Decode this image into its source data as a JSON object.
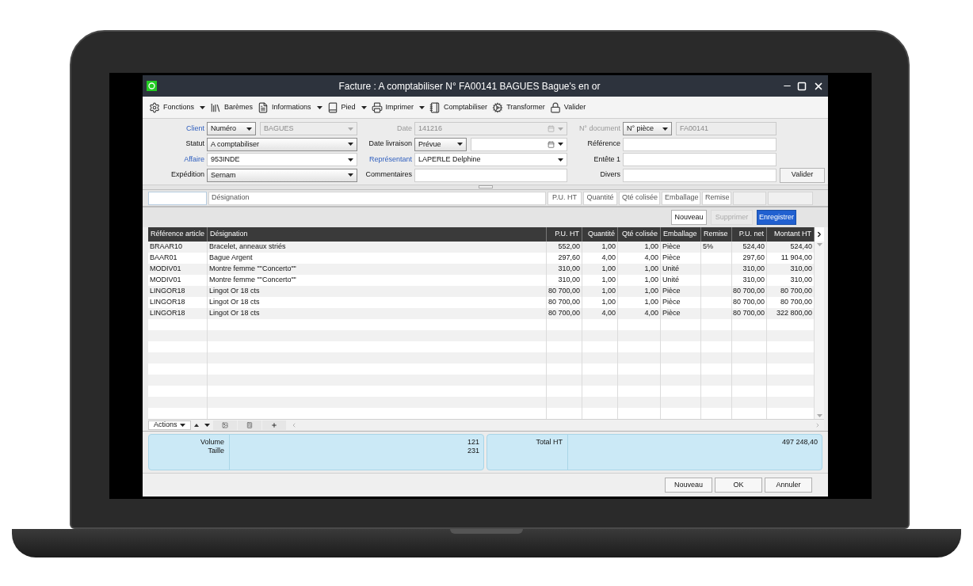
{
  "window": {
    "title": "Facture : A comptabiliser N° FA00141 BAGUES Bague's en or"
  },
  "toolbar": [
    {
      "label": "Fonctions",
      "menu": true
    },
    {
      "label": "Barèmes",
      "menu": false
    },
    {
      "label": "Informations",
      "menu": true
    },
    {
      "label": "Pied",
      "menu": true
    },
    {
      "label": "Imprimer",
      "menu": true
    },
    {
      "label": "Comptabiliser",
      "menu": false
    },
    {
      "label": "Transformer",
      "menu": false
    },
    {
      "label": "Valider",
      "menu": false
    }
  ],
  "form": {
    "columns": [
      {
        "fields": [
          {
            "label": "Client",
            "link": true,
            "disabled": false,
            "controls": [
              {
                "kind": "select",
                "value": "Numéro",
                "disabled": false
              },
              {
                "kind": "select",
                "value": "BAGUES",
                "disabled": true
              }
            ]
          },
          {
            "label": "Statut",
            "link": false,
            "disabled": false,
            "controls": [
              {
                "kind": "select",
                "value": "A comptabiliser",
                "disabled": false
              }
            ]
          },
          {
            "label": "Affaire",
            "link": true,
            "disabled": false,
            "controls": [
              {
                "kind": "combo",
                "value": "953INDE",
                "disabled": false
              }
            ]
          },
          {
            "label": "Expédition",
            "link": false,
            "disabled": false,
            "controls": [
              {
                "kind": "select",
                "value": "Sernam",
                "disabled": false
              }
            ]
          }
        ]
      },
      {
        "fields": [
          {
            "label": "Date",
            "link": false,
            "disabled": true,
            "controls": [
              {
                "kind": "date",
                "value": "141216",
                "disabled": true
              }
            ]
          },
          {
            "label": "Date livraison",
            "link": false,
            "disabled": false,
            "controls": [
              {
                "kind": "select",
                "value": "Prévue",
                "disabled": false
              },
              {
                "kind": "date",
                "disabled": false
              }
            ]
          },
          {
            "label": "Représentant",
            "link": true,
            "disabled": false,
            "controls": [
              {
                "kind": "combo",
                "value": "LAPERLE Delphine",
                "disabled": false
              }
            ]
          },
          {
            "label": "Commentaires",
            "link": false,
            "disabled": false,
            "controls": [
              {
                "kind": "input",
                "disabled": false
              }
            ]
          }
        ]
      },
      {
        "fields": [
          {
            "label": "N° document",
            "link": false,
            "disabled": true,
            "controls": [
              {
                "kind": "select",
                "value": "N° pièce",
                "disabled": false
              },
              {
                "kind": "input",
                "value": "FA00141",
                "disabled": true
              }
            ]
          },
          {
            "label": "Référence",
            "link": false,
            "disabled": false,
            "controls": [
              {
                "kind": "input",
                "disabled": false
              }
            ]
          },
          {
            "label": "Entête 1",
            "link": false,
            "disabled": false,
            "controls": [
              {
                "kind": "input",
                "disabled": false
              }
            ]
          },
          {
            "label": "Divers",
            "link": false,
            "disabled": false,
            "controls": [
              {
                "kind": "input",
                "disabled": false
              }
            ],
            "button": "Valider"
          }
        ]
      }
    ]
  },
  "entry_bar": [
    {
      "placeholder": "Désignation"
    },
    {
      "placeholder": "P.U. HT"
    },
    {
      "placeholder": "Quantité"
    },
    {
      "placeholder": "Qté colisée"
    },
    {
      "placeholder": "Emballage"
    },
    {
      "placeholder": "Remise"
    }
  ],
  "line_buttons": [
    {
      "label": "Nouveau",
      "disabled": false,
      "primary": false
    },
    {
      "label": "Supprimer",
      "disabled": true,
      "primary": false
    },
    {
      "label": "Enregistrer",
      "disabled": false,
      "primary": true
    }
  ],
  "table": {
    "columns": [
      "Référence article",
      "Désignation",
      "P.U. HT",
      "Quantité",
      "Qté colisée",
      "Emballage",
      "Remise",
      "P.U. net",
      "Montant HT"
    ],
    "rows": [
      [
        "BRAAR10",
        "Bracelet, anneaux striés",
        "552,00",
        "1,00",
        "1,00",
        "Pièce",
        "5%",
        "524,40",
        "524,40"
      ],
      [
        "BAAR01",
        "Bague Argent",
        "297,60",
        "4,00",
        "4,00",
        "Pièce",
        "",
        "297,60",
        "11 904,00"
      ],
      [
        "MODIV01",
        "Montre femme \"\"Concerto\"\"",
        "310,00",
        "1,00",
        "1,00",
        "Unité",
        "",
        "310,00",
        "310,00"
      ],
      [
        "MODIV01",
        "Montre femme \"\"Concerto\"\"",
        "310,00",
        "1,00",
        "1,00",
        "Unité",
        "",
        "310,00",
        "310,00"
      ],
      [
        "LINGOR18",
        "Lingot Or 18 cts",
        "80 700,00",
        "1,00",
        "1,00",
        "Pièce",
        "",
        "80 700,00",
        "80 700,00"
      ],
      [
        "LINGOR18",
        "Lingot Or 18 cts",
        "80 700,00",
        "1,00",
        "1,00",
        "Pièce",
        "",
        "80 700,00",
        "80 700,00"
      ],
      [
        "LINGOR18",
        "Lingot Or 18 cts",
        "80 700,00",
        "4,00",
        "4,00",
        "Pièce",
        "",
        "80 700,00",
        "322 800,00"
      ]
    ]
  },
  "actions": {
    "label": "Actions"
  },
  "summary": [
    {
      "labels": [
        "Volume",
        "Taille"
      ],
      "values": [
        "121",
        "231"
      ]
    },
    {
      "labels": [
        "Total HT"
      ],
      "values": [
        "497 248,40"
      ]
    }
  ],
  "footer_buttons": [
    "Nouveau",
    "OK",
    "Annuler"
  ]
}
